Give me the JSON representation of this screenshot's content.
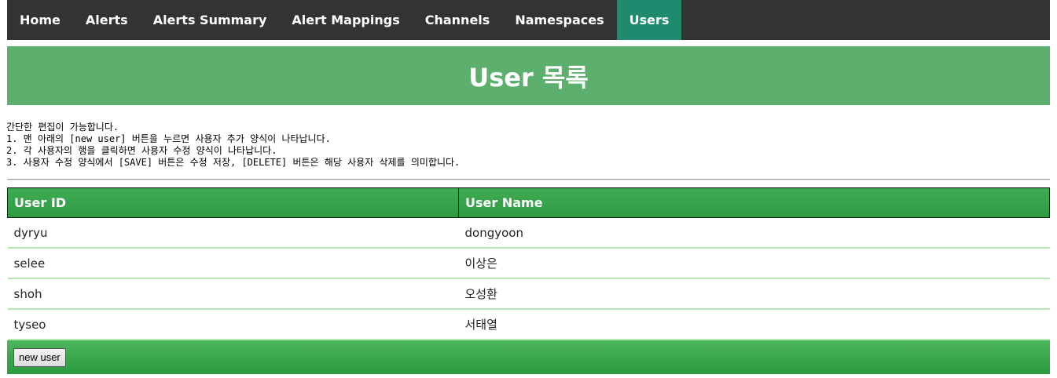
{
  "nav": {
    "items": [
      {
        "label": "Home",
        "active": false
      },
      {
        "label": "Alerts",
        "active": false
      },
      {
        "label": "Alerts Summary",
        "active": false
      },
      {
        "label": "Alert Mappings",
        "active": false
      },
      {
        "label": "Channels",
        "active": false
      },
      {
        "label": "Namespaces",
        "active": false
      },
      {
        "label": "Users",
        "active": true
      }
    ],
    "active_color": "#1e8a6e",
    "background_color": "#333333"
  },
  "page": {
    "title": "User 목록",
    "banner_color": "#5caf6c"
  },
  "instructions": {
    "lines": [
      "간단한 편집이 가능합니다.",
      "1. 맨 아래의 [new user] 버튼을 누르면 사용자 추가 양식이 나타납니다.",
      "2. 각 사용자의 행을 클릭하면 사용자 수정 양식이 나타납니다.",
      "3. 사용자 수정 양식에서 [SAVE] 버튼은 수정 저장, [DELETE] 버튼은 해당 사용자 삭제를 의미합니다."
    ]
  },
  "table": {
    "headers": {
      "user_id": "User ID",
      "user_name": "User Name"
    },
    "rows": [
      {
        "user_id": "dyryu",
        "user_name": "dongyoon"
      },
      {
        "user_id": "selee",
        "user_name": "이상은"
      },
      {
        "user_id": "shoh",
        "user_name": "오성환"
      },
      {
        "user_id": "tyseo",
        "user_name": "서태열"
      }
    ],
    "header_color": "#3fab52",
    "row_separator_color": "#b6e6b6"
  },
  "footer": {
    "new_user_label": "new user"
  }
}
